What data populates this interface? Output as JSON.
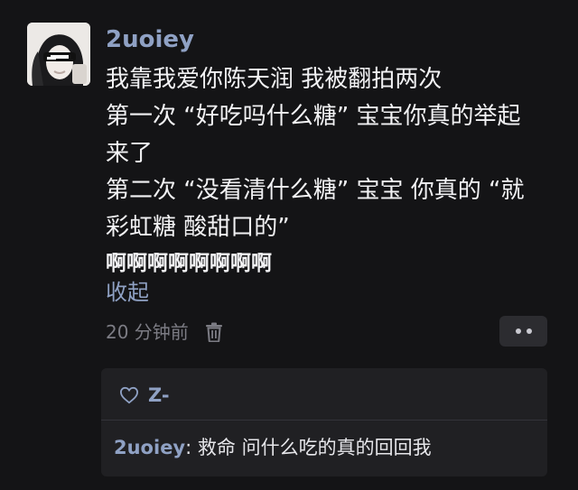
{
  "post": {
    "username": "2uoiey",
    "lines": [
      "我靠我爱你陈天润 我被翻拍两次",
      "第一次 “好吃吗什么糖” 宝宝你真的举起",
      "来了",
      "第二次 “没看清什么糖” 宝宝 你真的 “就",
      "彩虹糖 酸甜口的”"
    ],
    "emphasis": "啊啊啊啊啊啊啊啊",
    "collapse_label": "收起",
    "time": "20 分钟前",
    "delete_icon": "trash-icon",
    "more_icon": "more-dots-icon"
  },
  "reply_box": {
    "like_icon": "heart-outline-icon",
    "liker": "Z-",
    "reply": {
      "author": "2uoiey",
      "separator": ": ",
      "text": "救命 问什么吃的真的回回我"
    }
  },
  "colors": {
    "background": "#141416",
    "link": "#8fa1c4",
    "muted": "#7c7c84",
    "card": "#202023"
  }
}
